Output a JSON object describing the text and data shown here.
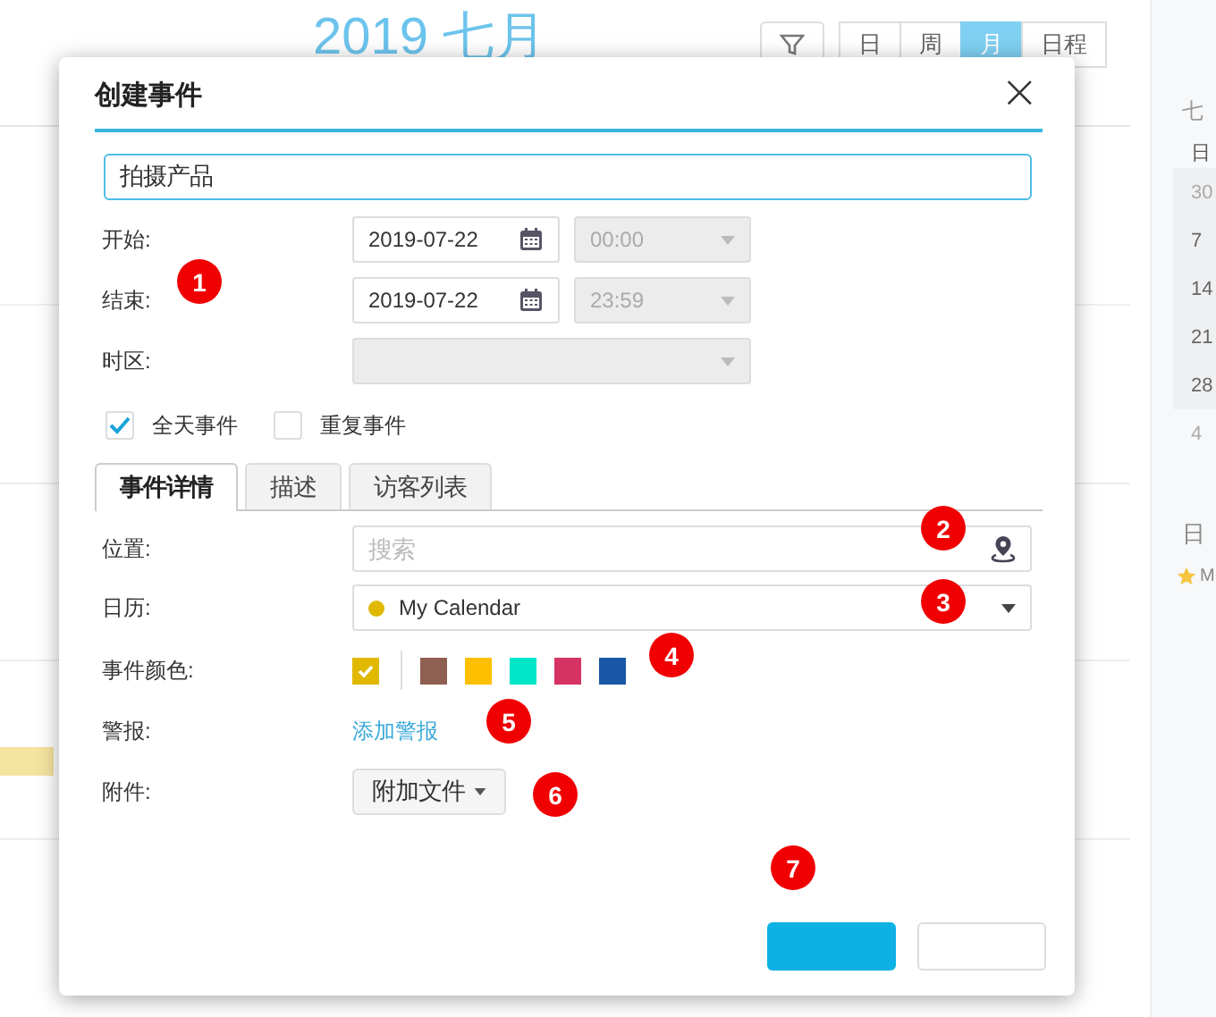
{
  "calendar": {
    "title": "2019 七月",
    "view_buttons": [
      {
        "label": "日",
        "selected": false
      },
      {
        "label": "周",
        "selected": false
      },
      {
        "label": "月",
        "selected": true
      },
      {
        "label": "日程",
        "selected": false
      }
    ],
    "mini_calendar": {
      "month": "七",
      "weekday": "日",
      "dates": [
        {
          "label": "30",
          "muted": true
        },
        {
          "label": "7",
          "muted": false
        },
        {
          "label": "14",
          "muted": false
        },
        {
          "label": "21",
          "muted": false
        },
        {
          "label": "28",
          "muted": false
        },
        {
          "label": "4",
          "muted": true
        }
      ],
      "section": "日",
      "calendar_item": "M"
    }
  },
  "dialog": {
    "title": "创建事件",
    "close": "×",
    "event_title": "拍摄产品",
    "start": {
      "label": "开始:",
      "date": "2019-07-22",
      "time": "00:00"
    },
    "end": {
      "label": "结束:",
      "date": "2019-07-22",
      "time": "23:59"
    },
    "timezone": {
      "label": "时区:"
    },
    "options": [
      {
        "label": "全天事件",
        "checked": true
      },
      {
        "label": "重复事件",
        "checked": false
      }
    ],
    "tabs": [
      {
        "label": "事件详情",
        "selected": true
      },
      {
        "label": "描述",
        "selected": false
      },
      {
        "label": "访客列表",
        "selected": false
      }
    ],
    "location": {
      "label": "位置:",
      "placeholder": "搜索"
    },
    "calendar": {
      "label": "日历:",
      "value": "My Calendar",
      "color": "#e0b800"
    },
    "event_color": {
      "label": "事件颜色:",
      "colors": [
        {
          "color": "#e0b800",
          "selected": true
        },
        {
          "color": "#8f5f52",
          "selected": false
        },
        {
          "color": "#fcc000",
          "selected": false
        },
        {
          "color": "#00e6c9",
          "selected": false
        },
        {
          "color": "#d63365",
          "selected": false
        },
        {
          "color": "#1757a5",
          "selected": false
        }
      ]
    },
    "alert": {
      "label": "警报:",
      "link": "添加警报"
    },
    "attachment": {
      "label": "附件:",
      "button": "附加文件"
    }
  },
  "markers": [
    "1",
    "2",
    "3",
    "4",
    "5",
    "6",
    "7"
  ]
}
